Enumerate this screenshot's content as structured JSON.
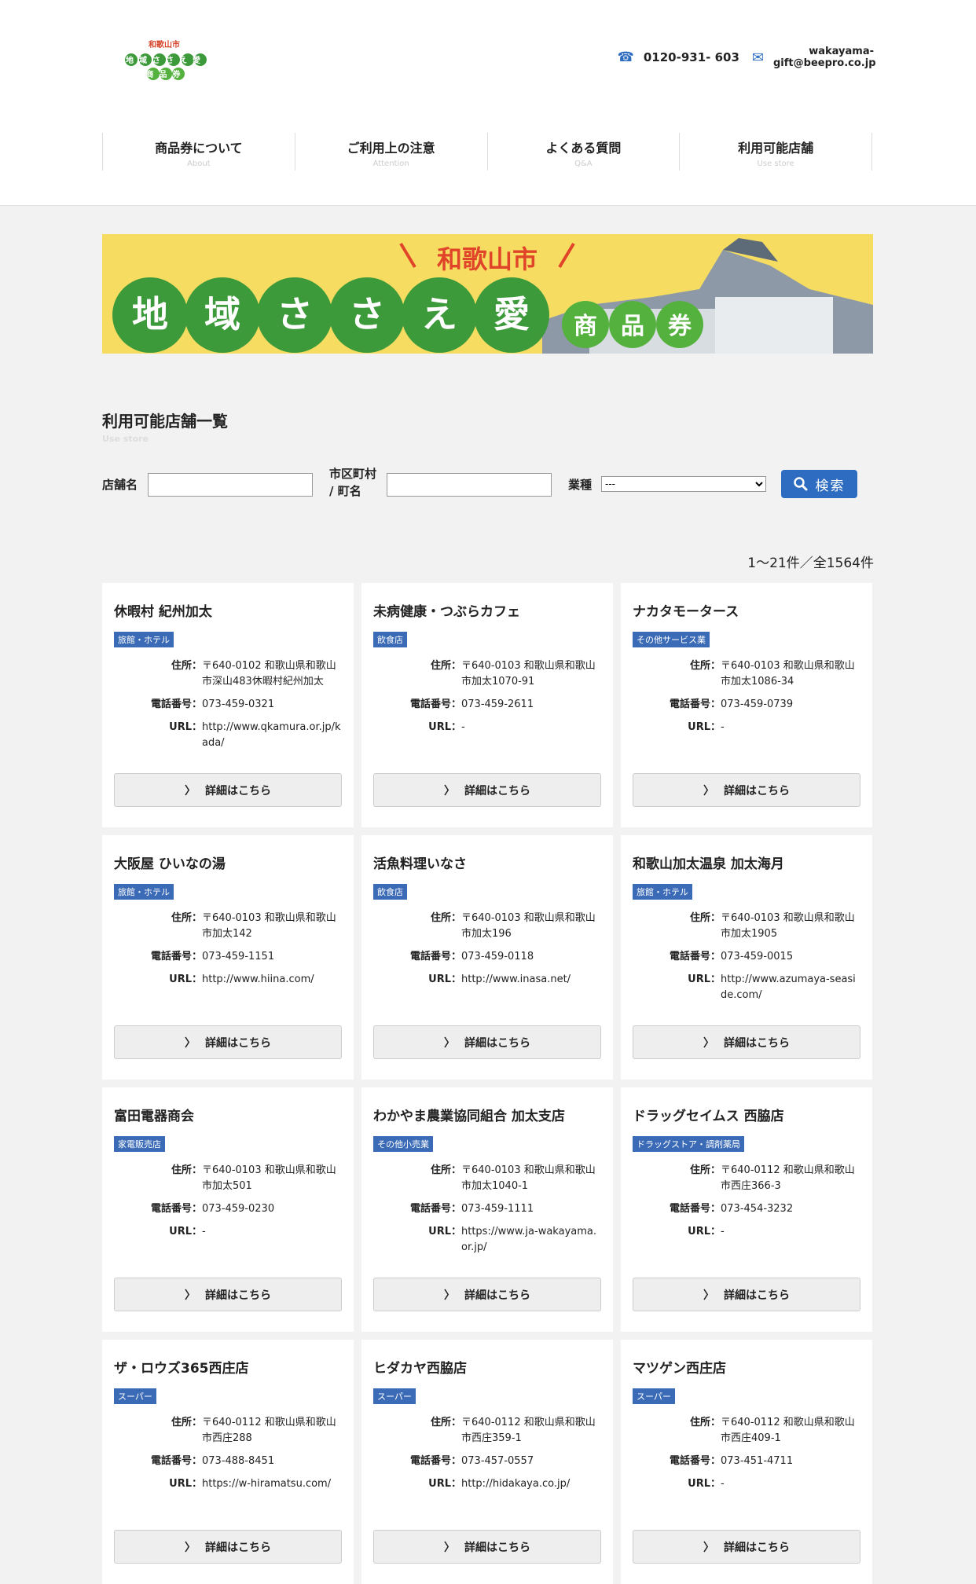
{
  "header": {
    "logo_line1": "和歌山市",
    "logo_line2": "地域ささえ愛",
    "logo_line3": "商品券",
    "phone": "0120-931- 603",
    "email": "wakayama-gift@beepro.co.jp",
    "nav": [
      {
        "label": "商品券について",
        "en": "About"
      },
      {
        "label": "ご利用上の注意",
        "en": "Attention"
      },
      {
        "label": "よくある質問",
        "en": "Q&A"
      },
      {
        "label": "利用可能店舗",
        "en": "Use store"
      }
    ]
  },
  "banner": {
    "city": "和歌山市",
    "chars": [
      "地",
      "域",
      "さ",
      "さ",
      "え",
      "愛"
    ],
    "small_chars": [
      "商",
      "品",
      "券"
    ]
  },
  "section": {
    "title": "利用可能店舗一覧",
    "subtitle": "Use store"
  },
  "search": {
    "shop_label": "店舗名",
    "city_label_1": "市区町村",
    "city_label_2": "/ 町名",
    "type_label": "業種",
    "type_selected": "---",
    "button_label": "検索"
  },
  "count": "1～21件／全1564件",
  "labels": {
    "address": "住所：",
    "phone": "電話番号：",
    "url": "URL：",
    "detail": "詳細はこちら"
  },
  "shops": [
    {
      "name": "休暇村 紀州加太",
      "category": "旅館・ホテル",
      "address": "〒640-0102 和歌山県和歌山市深山483休暇村紀州加太",
      "phone": "073-459-0321",
      "url": "http://www.qkamura.or.jp/kada/"
    },
    {
      "name": "未病健康・つぶらカフェ",
      "category": "飲食店",
      "address": "〒640-0103 和歌山県和歌山市加太1070-91",
      "phone": "073-459-2611",
      "url": "-"
    },
    {
      "name": "ナカタモータース",
      "category": "その他サービス業",
      "address": "〒640-0103 和歌山県和歌山市加太1086-34",
      "phone": "073-459-0739",
      "url": "-"
    },
    {
      "name": "大阪屋 ひいなの湯",
      "category": "旅館・ホテル",
      "address": "〒640-0103 和歌山県和歌山市加太142",
      "phone": "073-459-1151",
      "url": "http://www.hiina.com/"
    },
    {
      "name": "活魚料理いなさ",
      "category": "飲食店",
      "address": "〒640-0103 和歌山県和歌山市加太196",
      "phone": "073-459-0118",
      "url": "http://www.inasa.net/"
    },
    {
      "name": "和歌山加太温泉 加太海月",
      "category": "旅館・ホテル",
      "address": "〒640-0103 和歌山県和歌山市加太1905",
      "phone": "073-459-0015",
      "url": "http://www.azumaya-seaside.com/"
    },
    {
      "name": "富田電器商会",
      "category": "家電販売店",
      "address": "〒640-0103 和歌山県和歌山市加太501",
      "phone": "073-459-0230",
      "url": "-"
    },
    {
      "name": "わかやま農業協同組合 加太支店",
      "category": "その他小売業",
      "address": "〒640-0103 和歌山県和歌山市加太1040-1",
      "phone": "073-459-1111",
      "url": "https://www.ja-wakayama.or.jp/"
    },
    {
      "name": "ドラッグセイムス 西脇店",
      "category": "ドラッグストア・調剤薬局",
      "address": "〒640-0112 和歌山県和歌山市西庄366-3",
      "phone": "073-454-3232",
      "url": "-"
    },
    {
      "name": "ザ・ロウズ365西庄店",
      "category": "スーパー",
      "address": "〒640-0112 和歌山県和歌山市西庄288",
      "phone": "073-488-8451",
      "url": "https://w-hiramatsu.com/"
    },
    {
      "name": "ヒダカヤ西脇店",
      "category": "スーパー",
      "address": "〒640-0112 和歌山県和歌山市西庄359-1",
      "phone": "073-457-0557",
      "url": "http://hidakaya.co.jp/"
    },
    {
      "name": "マツゲン西庄店",
      "category": "スーパー",
      "address": "〒640-0112 和歌山県和歌山市西庄409-1",
      "phone": "073-451-4711",
      "url": "-"
    }
  ]
}
